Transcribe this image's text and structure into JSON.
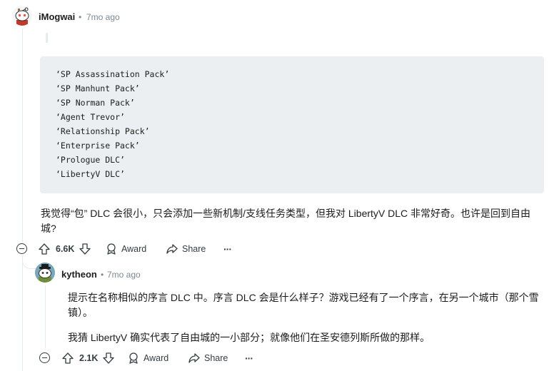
{
  "comment": {
    "author": "iMogwai",
    "separator": "•",
    "age": "7mo ago",
    "code_lines": [
      "‘SP Assassination Pack’",
      "‘SP Manhunt Pack’",
      "‘SP Norman Pack’",
      "‘Agent Trevor’",
      "‘Relationship Pack’",
      "‘Enterprise Pack’",
      "‘Prologue DLC’",
      "‘LibertyV DLC’"
    ],
    "text_line1": "我觉得“包” DLC 会很小，只会添加一些新机制/支线任务类型，但我对 LibertyV DLC 非常好奇。也许是回到自由",
    "text_line2": "城?",
    "votes": "6.6K",
    "award_label": "Award",
    "share_label": "Share",
    "more_label": "···"
  },
  "reply": {
    "author": "kytheon",
    "separator": "•",
    "age": "7mo ago",
    "text_line1": "提示在名称相似的序言 DLC 中。序言 DLC 会是什么样子？游戏已经有了一个序言，在另一个城市（那个雪",
    "text_line2": "镇）。",
    "text_line3": "我猜 LibertyV 确实代表了自由城的一小部分；就像他们在圣安德列斯所做的那样。",
    "votes": "2.1K",
    "award_label": "Award",
    "share_label": "Share",
    "more_label": "···"
  },
  "colors": {
    "meta_text": "#7c8a91",
    "code_bg": "#ebeff1",
    "thread_line": "#e5ebee",
    "action_text": "#333d42"
  }
}
